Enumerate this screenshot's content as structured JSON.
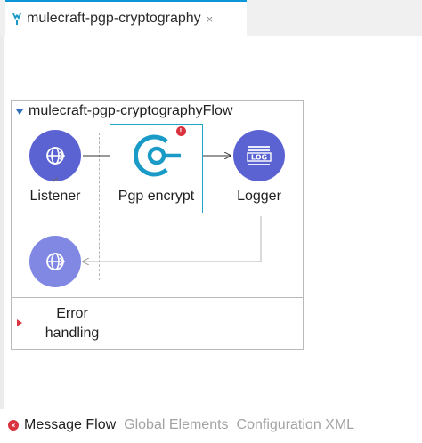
{
  "editor_tab": {
    "label": "mulecraft-pgp-cryptography",
    "close_glyph": "×",
    "icon": "mule-icon"
  },
  "flow": {
    "title": "mulecraft-pgp-cryptographyFlow",
    "processors": [
      {
        "label": "Listener",
        "icon": "globe-icon"
      },
      {
        "label": "Pgp encrypt",
        "icon": "pgp-crypto-icon"
      },
      {
        "label": "Logger",
        "icon": "log-icon"
      }
    ],
    "response_icon": "globe-icon",
    "log_text": "LOG",
    "error_badge": "!",
    "sync_glyph": "⇌",
    "error_handling": {
      "line1": "Error",
      "line2": "handling"
    }
  },
  "bottom_tabs": {
    "error_badge": "×",
    "items": [
      {
        "label": "Message Flow",
        "active": true
      },
      {
        "label": "Global Elements",
        "active": false
      },
      {
        "label": "Configuration XML",
        "active": false
      }
    ]
  },
  "colors": {
    "processor": "#5b63d3",
    "pgp_accent": "#1a9bc7",
    "selection": "#23a4c6",
    "error": "#d9333f",
    "active_tab_border": "#0a96d8"
  }
}
